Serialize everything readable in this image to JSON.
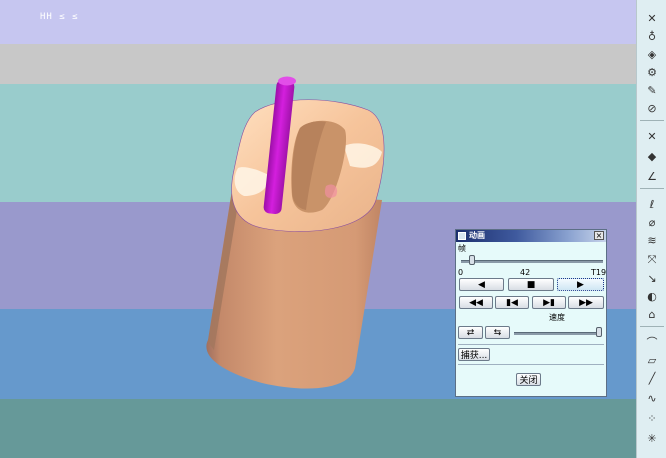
{
  "viewport": {
    "top_readout": "HH ≤ ≤",
    "bands": [
      "#c6c6f0",
      "#c8c8c8",
      "#99cccc",
      "#9999cc",
      "#6699cc",
      "#669999"
    ]
  },
  "toolbar": {
    "tools": [
      {
        "name": "tool-1-icon",
        "glyph": "✕"
      },
      {
        "name": "tool-2-icon",
        "glyph": "♁"
      },
      {
        "name": "tool-3-icon",
        "glyph": "◈"
      },
      {
        "name": "tool-4-icon",
        "glyph": "⚙"
      },
      {
        "name": "tool-5-icon",
        "glyph": "✎"
      },
      {
        "name": "tool-6-icon",
        "glyph": "⊘"
      },
      {
        "name": "tool-7-icon",
        "glyph": "✕"
      },
      {
        "name": "tool-8-icon",
        "glyph": "◆"
      },
      {
        "name": "tool-9-icon",
        "glyph": "∠"
      },
      {
        "name": "tool-10-icon",
        "glyph": "ℓ"
      },
      {
        "name": "tool-11-icon",
        "glyph": "⌀"
      },
      {
        "name": "tool-12-icon",
        "glyph": "≋"
      },
      {
        "name": "tool-13-icon",
        "glyph": "⤧"
      },
      {
        "name": "tool-14-icon",
        "glyph": "↘"
      },
      {
        "name": "tool-15-icon",
        "glyph": "◐"
      },
      {
        "name": "tool-16-icon",
        "glyph": "⌂"
      },
      {
        "name": "tool-17-icon",
        "glyph": "⌒"
      },
      {
        "name": "tool-18-icon",
        "glyph": "▱"
      },
      {
        "name": "tool-19-icon",
        "glyph": "╱"
      },
      {
        "name": "tool-20-icon",
        "glyph": "∿"
      },
      {
        "name": "tool-21-icon",
        "glyph": "⁘"
      },
      {
        "name": "tool-22-icon",
        "glyph": "✳"
      }
    ]
  },
  "animation_dialog": {
    "title": "动画",
    "close_glyph": "×",
    "frame_label": "帧",
    "frame_min": "0",
    "frame_current": "42",
    "frame_max": "T19",
    "frame_progress": 0.06,
    "speed_label": "速度",
    "speed_progress": 1.0,
    "buttons": {
      "step_back": "◀",
      "stop": "■",
      "play": "▶",
      "rewind": "◀◀",
      "to_start": "▮◀",
      "to_end": "▶▮",
      "fast_forward": "▶▶",
      "loop": "⇄",
      "bounce": "⇆"
    },
    "capture_label": "捕获...",
    "close_label": "关闭"
  }
}
